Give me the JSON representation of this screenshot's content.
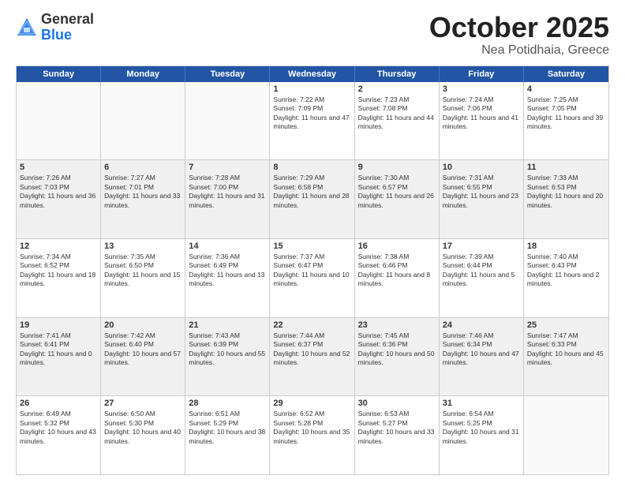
{
  "header": {
    "logo_general": "General",
    "logo_blue": "Blue",
    "month_title": "October 2025",
    "location": "Nea Potidhaia, Greece"
  },
  "calendar": {
    "days_of_week": [
      "Sunday",
      "Monday",
      "Tuesday",
      "Wednesday",
      "Thursday",
      "Friday",
      "Saturday"
    ],
    "rows": [
      [
        {
          "day": "",
          "content": "",
          "empty": true
        },
        {
          "day": "",
          "content": "",
          "empty": true
        },
        {
          "day": "",
          "content": "",
          "empty": true
        },
        {
          "day": "1",
          "content": "Sunrise: 7:22 AM\nSunset: 7:09 PM\nDaylight: 11 hours and 47 minutes."
        },
        {
          "day": "2",
          "content": "Sunrise: 7:23 AM\nSunset: 7:08 PM\nDaylight: 11 hours and 44 minutes."
        },
        {
          "day": "3",
          "content": "Sunrise: 7:24 AM\nSunset: 7:06 PM\nDaylight: 11 hours and 41 minutes."
        },
        {
          "day": "4",
          "content": "Sunrise: 7:25 AM\nSunset: 7:05 PM\nDaylight: 11 hours and 39 minutes."
        }
      ],
      [
        {
          "day": "5",
          "content": "Sunrise: 7:26 AM\nSunset: 7:03 PM\nDaylight: 11 hours and 36 minutes.",
          "shaded": true
        },
        {
          "day": "6",
          "content": "Sunrise: 7:27 AM\nSunset: 7:01 PM\nDaylight: 11 hours and 33 minutes.",
          "shaded": true
        },
        {
          "day": "7",
          "content": "Sunrise: 7:28 AM\nSunset: 7:00 PM\nDaylight: 11 hours and 31 minutes.",
          "shaded": true
        },
        {
          "day": "8",
          "content": "Sunrise: 7:29 AM\nSunset: 6:58 PM\nDaylight: 11 hours and 28 minutes.",
          "shaded": true
        },
        {
          "day": "9",
          "content": "Sunrise: 7:30 AM\nSunset: 6:57 PM\nDaylight: 11 hours and 26 minutes.",
          "shaded": true
        },
        {
          "day": "10",
          "content": "Sunrise: 7:31 AM\nSunset: 6:55 PM\nDaylight: 11 hours and 23 minutes.",
          "shaded": true
        },
        {
          "day": "11",
          "content": "Sunrise: 7:33 AM\nSunset: 6:53 PM\nDaylight: 11 hours and 20 minutes.",
          "shaded": true
        }
      ],
      [
        {
          "day": "12",
          "content": "Sunrise: 7:34 AM\nSunset: 6:52 PM\nDaylight: 11 hours and 18 minutes."
        },
        {
          "day": "13",
          "content": "Sunrise: 7:35 AM\nSunset: 6:50 PM\nDaylight: 11 hours and 15 minutes."
        },
        {
          "day": "14",
          "content": "Sunrise: 7:36 AM\nSunset: 6:49 PM\nDaylight: 11 hours and 13 minutes."
        },
        {
          "day": "15",
          "content": "Sunrise: 7:37 AM\nSunset: 6:47 PM\nDaylight: 11 hours and 10 minutes."
        },
        {
          "day": "16",
          "content": "Sunrise: 7:38 AM\nSunset: 6:46 PM\nDaylight: 11 hours and 8 minutes."
        },
        {
          "day": "17",
          "content": "Sunrise: 7:39 AM\nSunset: 6:44 PM\nDaylight: 11 hours and 5 minutes."
        },
        {
          "day": "18",
          "content": "Sunrise: 7:40 AM\nSunset: 6:43 PM\nDaylight: 11 hours and 2 minutes."
        }
      ],
      [
        {
          "day": "19",
          "content": "Sunrise: 7:41 AM\nSunset: 6:41 PM\nDaylight: 11 hours and 0 minutes.",
          "shaded": true
        },
        {
          "day": "20",
          "content": "Sunrise: 7:42 AM\nSunset: 6:40 PM\nDaylight: 10 hours and 57 minutes.",
          "shaded": true
        },
        {
          "day": "21",
          "content": "Sunrise: 7:43 AM\nSunset: 6:39 PM\nDaylight: 10 hours and 55 minutes.",
          "shaded": true
        },
        {
          "day": "22",
          "content": "Sunrise: 7:44 AM\nSunset: 6:37 PM\nDaylight: 10 hours and 52 minutes.",
          "shaded": true
        },
        {
          "day": "23",
          "content": "Sunrise: 7:45 AM\nSunset: 6:36 PM\nDaylight: 10 hours and 50 minutes.",
          "shaded": true
        },
        {
          "day": "24",
          "content": "Sunrise: 7:46 AM\nSunset: 6:34 PM\nDaylight: 10 hours and 47 minutes.",
          "shaded": true
        },
        {
          "day": "25",
          "content": "Sunrise: 7:47 AM\nSunset: 6:33 PM\nDaylight: 10 hours and 45 minutes.",
          "shaded": true
        }
      ],
      [
        {
          "day": "26",
          "content": "Sunrise: 6:49 AM\nSunset: 5:32 PM\nDaylight: 10 hours and 43 minutes."
        },
        {
          "day": "27",
          "content": "Sunrise: 6:50 AM\nSunset: 5:30 PM\nDaylight: 10 hours and 40 minutes."
        },
        {
          "day": "28",
          "content": "Sunrise: 6:51 AM\nSunset: 5:29 PM\nDaylight: 10 hours and 38 minutes."
        },
        {
          "day": "29",
          "content": "Sunrise: 6:52 AM\nSunset: 5:28 PM\nDaylight: 10 hours and 35 minutes."
        },
        {
          "day": "30",
          "content": "Sunrise: 6:53 AM\nSunset: 5:27 PM\nDaylight: 10 hours and 33 minutes."
        },
        {
          "day": "31",
          "content": "Sunrise: 6:54 AM\nSunset: 5:25 PM\nDaylight: 10 hours and 31 minutes."
        },
        {
          "day": "",
          "content": "",
          "empty": true
        }
      ]
    ]
  }
}
